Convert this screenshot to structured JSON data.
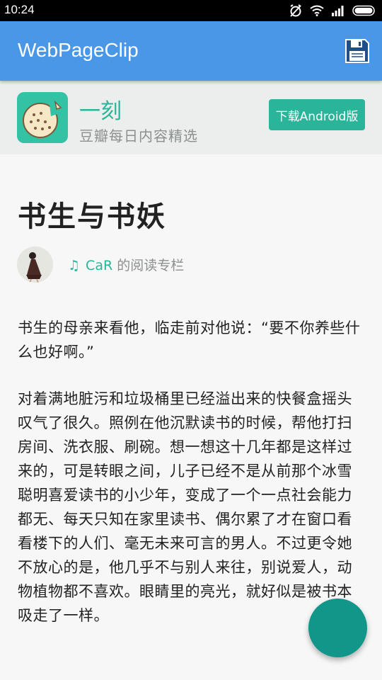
{
  "status_bar": {
    "time": "10:24",
    "icons": [
      "alarm-off-icon",
      "wifi-icon",
      "signal-icon",
      "battery-icon"
    ]
  },
  "app_bar": {
    "title": "WebPageClip",
    "action_icon": "save-icon",
    "color": "#4a97e8"
  },
  "banner": {
    "app_name": "一刻",
    "tagline": "豆瓣每日内容精选",
    "download_label": "下载Android版",
    "accent": "#2ab59a"
  },
  "article": {
    "title": "书生与书妖",
    "author_name": "CaR",
    "author_suffix": "的阅读专栏",
    "paragraphs": [
      "书生的母亲来看他，临走前对他说：“要不你养些什么也好啊。”",
      "对着满地脏污和垃圾桶里已经溢出来的快餐盒摇头叹气了很久。照例在他沉默读书的时候，帮他打扫房间、洗衣服、刷碗。想一想这十几年都是这样过来的，可是转眼之间，儿子已经不是从前那个冰雪聪明喜爱读书的小少年，变成了一个一点社会能力都无、每天只知在家里读书、偶尔累了才在窗口看看楼下的人们、毫无未来可言的男人。不过更令她不放心的是，他几乎不与别人来往，别说爱人，动物植物都不喜欢。眼睛里的亮光，就好似是被书本吸走了一样。"
    ]
  },
  "fab": {
    "color": "#13968a"
  }
}
